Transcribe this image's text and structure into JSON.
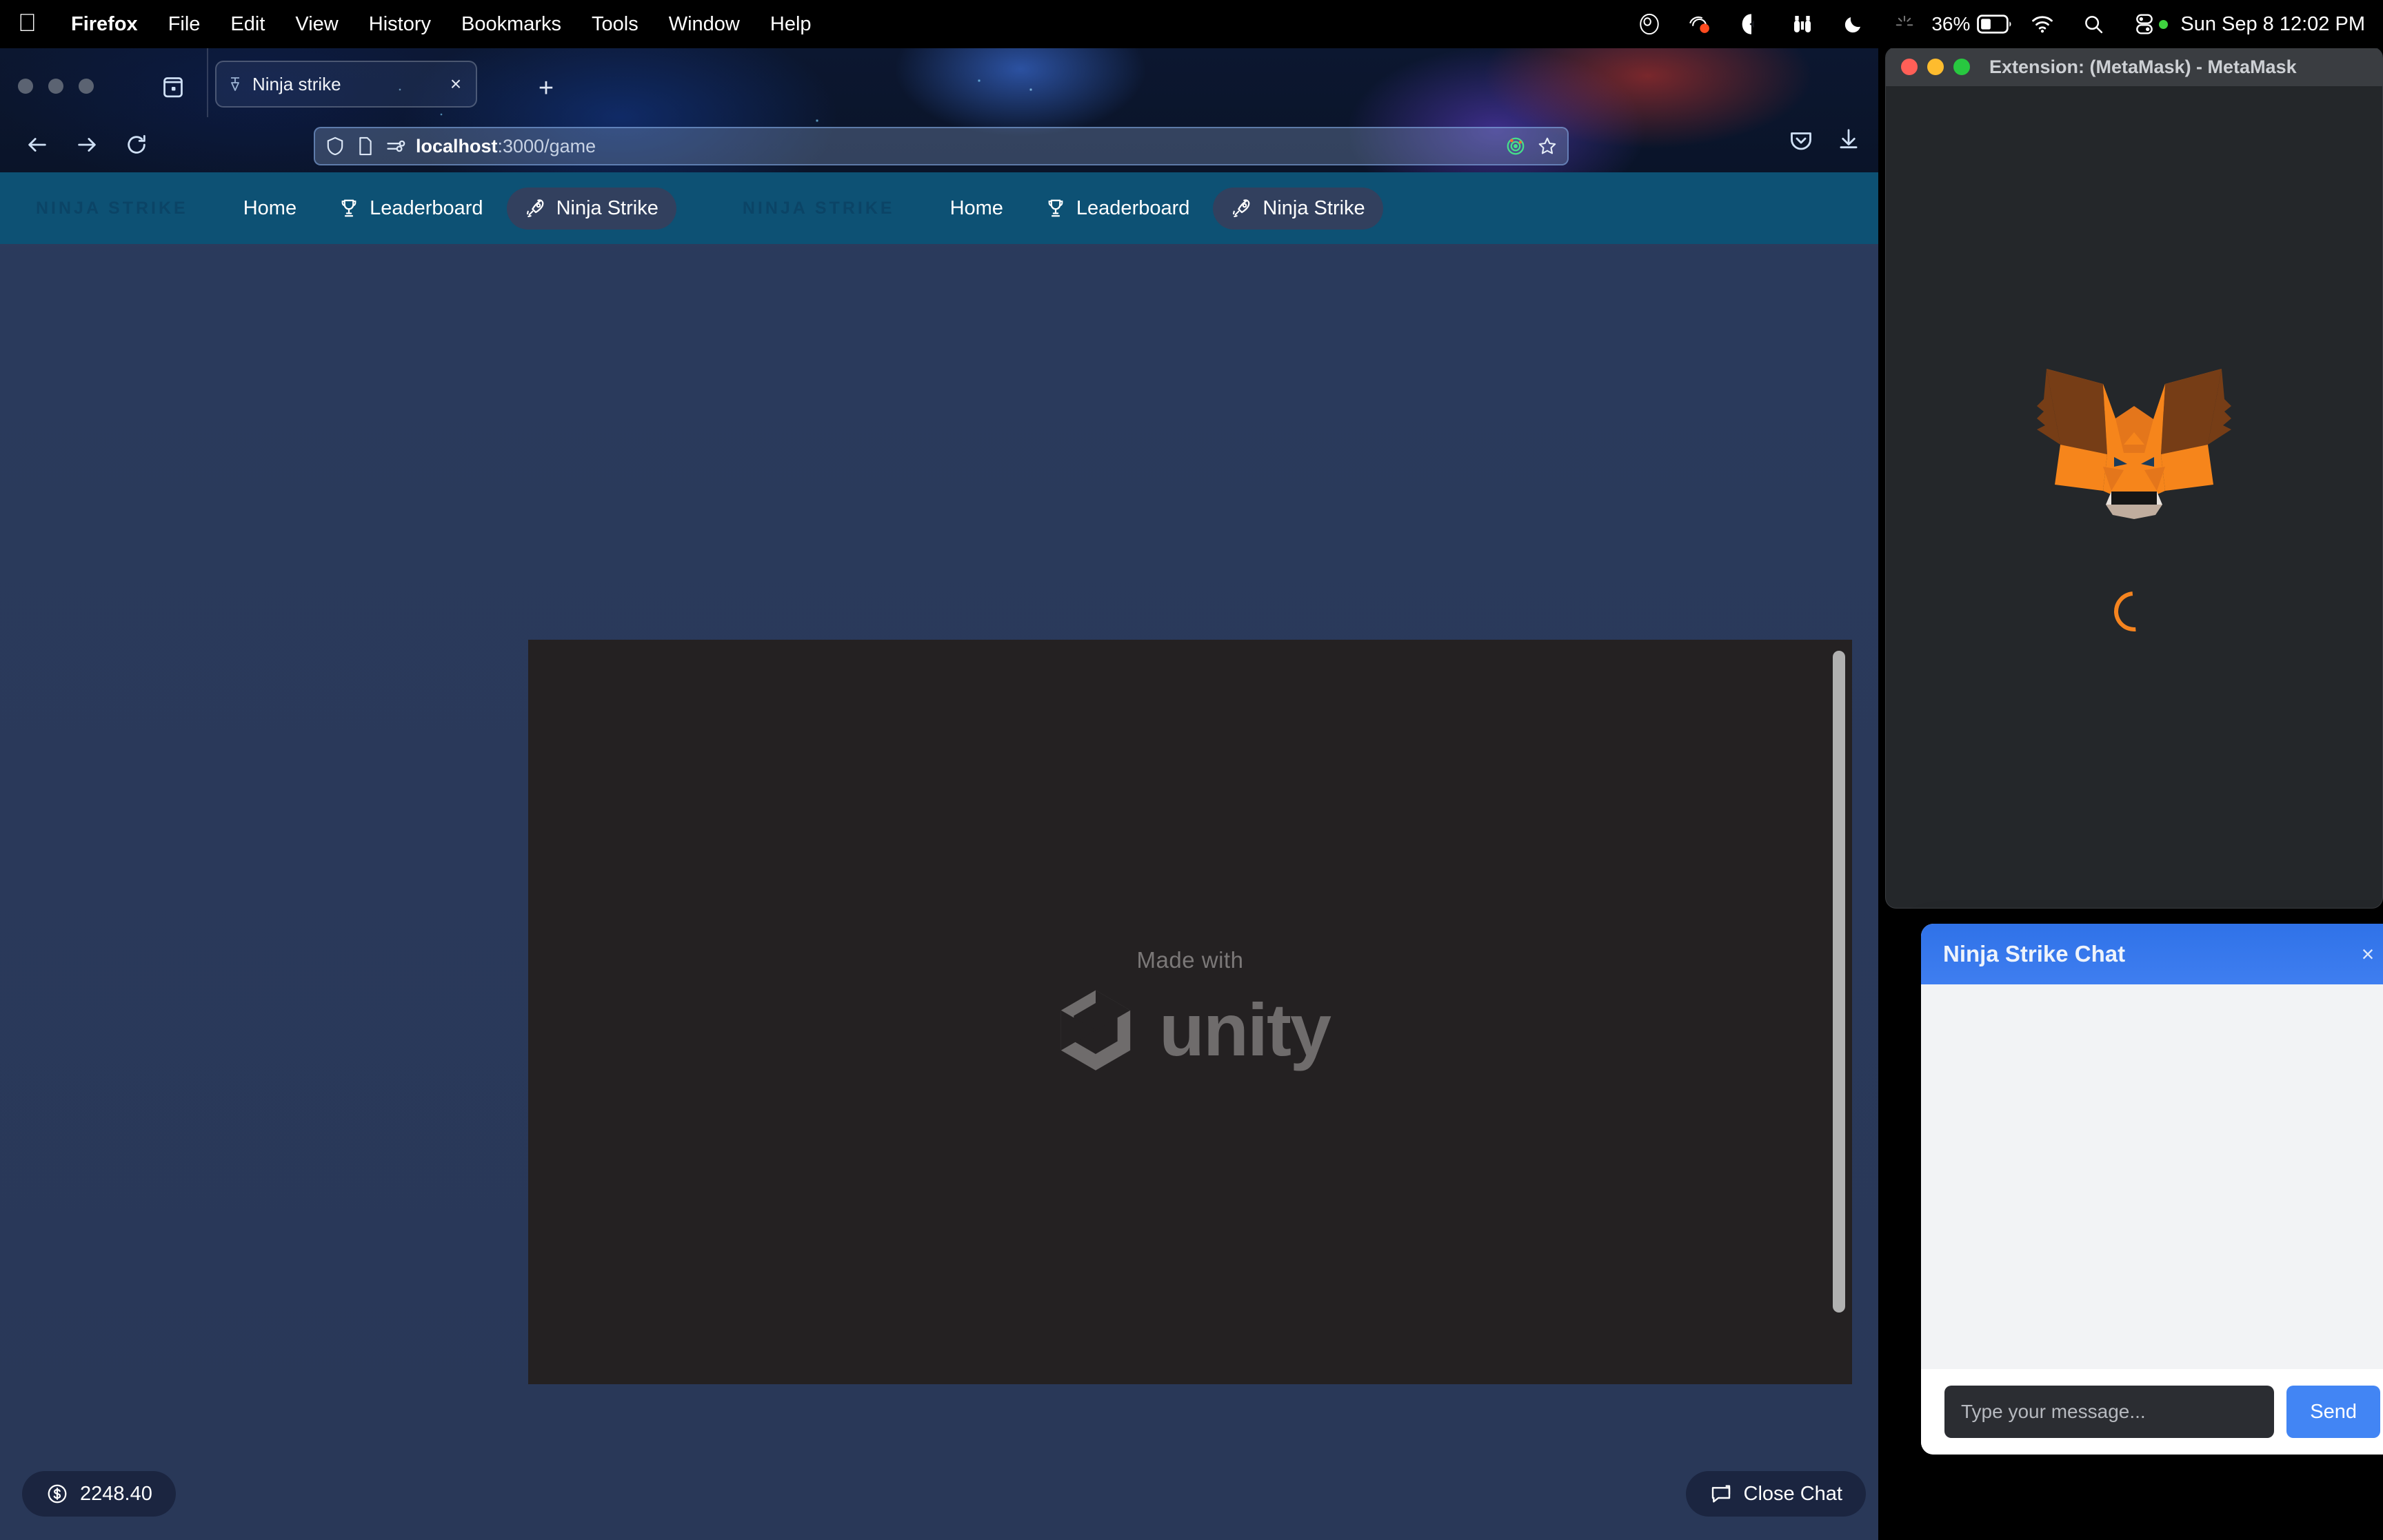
{
  "macbar": {
    "apple_glyph": "",
    "menus": [
      {
        "label": "Firefox",
        "bold": true
      },
      {
        "label": "File",
        "bold": false
      },
      {
        "label": "Edit",
        "bold": false
      },
      {
        "label": "View",
        "bold": false
      },
      {
        "label": "History",
        "bold": false
      },
      {
        "label": "Bookmarks",
        "bold": false
      },
      {
        "label": "Tools",
        "bold": false
      },
      {
        "label": "Window",
        "bold": false
      },
      {
        "label": "Help",
        "bold": false
      }
    ],
    "status_icons": [
      "obs-icon",
      "notification-badge-icon",
      "location-arrow-icon",
      "binoculars-icon",
      "moon-icon",
      "brightness-icon"
    ],
    "battery_percent": "36%",
    "right_icons": [
      "wifi-icon",
      "search-icon",
      "control-center-icon"
    ],
    "clock": "Sun Sep 8  12:02 PM"
  },
  "browser": {
    "tab": {
      "title": "Ninja strike",
      "close_label": "×"
    },
    "new_tab_label": "+",
    "url": {
      "host": "localhost",
      "path": ":3000/game",
      "full": "localhost:3000/game"
    },
    "nav_icons": [
      "back-icon",
      "forward-icon",
      "reload-icon"
    ],
    "url_icons": [
      "shield-icon",
      "page-info-icon",
      "permissions-icon"
    ],
    "url_right_icons": [
      "tracking-protection-icon",
      "bookmark-star-icon"
    ],
    "chrome_right_icons": [
      "pocket-save-icon",
      "downloads-icon"
    ]
  },
  "site": {
    "brand": "NINJA STRIKE",
    "brand_secondary": "NINJA STRIKE",
    "nav_primary": [
      {
        "label": "Home",
        "icon": "",
        "active": false
      },
      {
        "label": "Leaderboard",
        "icon": "trophy-icon",
        "active": false
      },
      {
        "label": "Ninja Strike",
        "icon": "rocket-icon",
        "active": true
      }
    ],
    "nav_secondary": [
      {
        "label": "Home",
        "icon": "",
        "active": false
      },
      {
        "label": "Leaderboard",
        "icon": "trophy-icon",
        "active": false
      },
      {
        "label": "Ninja Strike",
        "icon": "rocket-icon",
        "active": true
      }
    ],
    "score": {
      "icon": "coin-dollar-icon",
      "value": "2248.40"
    },
    "close_chat": {
      "icon": "chat-bubble-icon",
      "label": "Close Chat"
    }
  },
  "unity": {
    "made_with": "Made with",
    "wordmark": "unity"
  },
  "metamask": {
    "window_title": "Extension: (MetaMask) - MetaMask",
    "state": "loading",
    "logo": "metamask-fox-logo",
    "accent": "#f5841f"
  },
  "chat": {
    "title": "Ninja Strike Chat",
    "close_label": "×",
    "messages": [],
    "input_placeholder": "Type your message...",
    "input_value": "",
    "send_label": "Send",
    "accent": "#4285f4"
  },
  "colors": {
    "site_nav": "#0d5174",
    "page_bg": "#2a3a5c",
    "active_pill": "#32405e",
    "unity_canvas": "#242122",
    "metamask_bg": "#24272a"
  }
}
